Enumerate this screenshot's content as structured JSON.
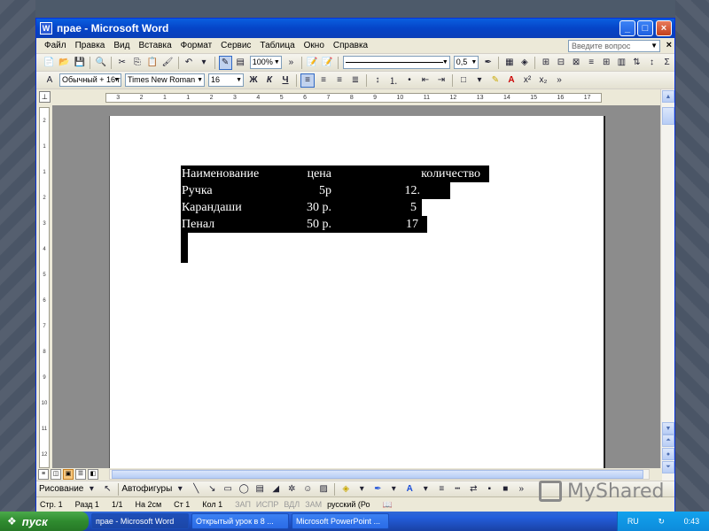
{
  "window": {
    "title": "прае - Microsoft Word",
    "min_label": "_",
    "max_label": "□",
    "close_label": "×"
  },
  "menu": {
    "items": [
      "Файл",
      "Правка",
      "Вид",
      "Вставка",
      "Формат",
      "Сервис",
      "Таблица",
      "Окно",
      "Справка"
    ],
    "help_placeholder": "Введите вопрос",
    "close_label": "×"
  },
  "toolbar1": {
    "zoom": "100%",
    "line_width": "0,5"
  },
  "toolbar2": {
    "style": "Обычный + 16 г",
    "font": "Times New Roman",
    "size": "16",
    "bold": "Ж",
    "italic": "К",
    "underline": "Ч",
    "text_color_label": "А",
    "superscript_label": "x²",
    "subscript_label": "x₂"
  },
  "ruler": {
    "h_ticks": [
      "3",
      "2",
      "1",
      "1",
      "2",
      "3",
      "4",
      "5",
      "6",
      "7",
      "8",
      "9",
      "10",
      "11",
      "12",
      "13",
      "14",
      "15",
      "16",
      "17"
    ],
    "v_ticks": [
      "2",
      "1",
      "1",
      "2",
      "3",
      "4",
      "5",
      "6",
      "7",
      "8",
      "9",
      "10",
      "11",
      "12"
    ]
  },
  "document": {
    "table": [
      [
        "Наименование",
        "цена",
        "количество"
      ],
      [
        "Ручка",
        "5р",
        "12."
      ],
      [
        "Карандаши",
        "30 р.",
        "5"
      ],
      [
        "Пенал",
        "50 р.",
        "17"
      ]
    ]
  },
  "drawbar": {
    "draw_label": "Рисование",
    "autoshapes_label": "Автофигуры"
  },
  "status": {
    "page": "Стр. 1",
    "section": "Разд 1",
    "pages": "1/1",
    "at": "На 2см",
    "line": "Ст 1",
    "col": "Кол 1",
    "rec": "ЗАП",
    "trk": "ИСПР",
    "ext": "ВДЛ",
    "ovr": "ЗАМ",
    "lang": "русский (Ро"
  },
  "taskbar": {
    "start_label": "пуск",
    "tasks": [
      "прае - Microsoft Word",
      "Открытый урок в 8 ...",
      "Microsoft PowerPoint ..."
    ],
    "lang": "RU",
    "time": "0:43"
  },
  "watermark": "MyShared"
}
